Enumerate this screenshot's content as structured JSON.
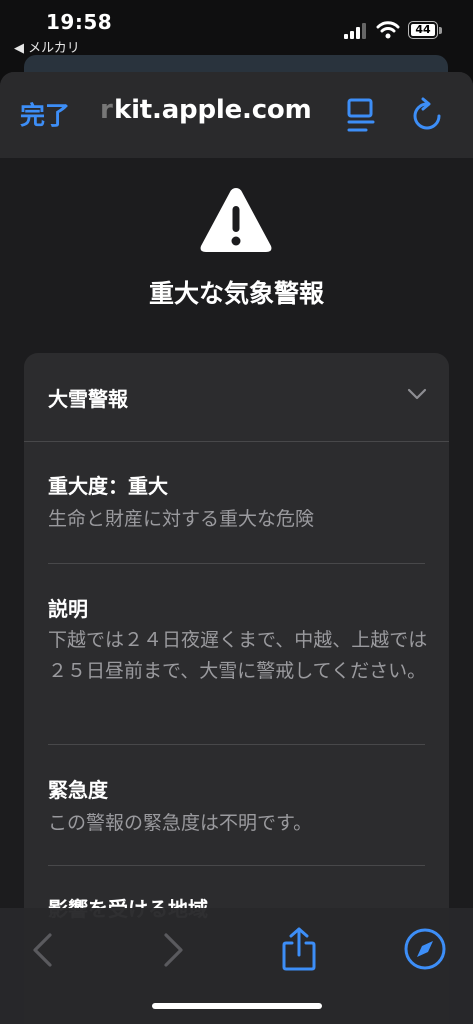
{
  "status_bar": {
    "time": "19:58",
    "back_app": "◀ メルカリ",
    "battery_level": "44"
  },
  "nav": {
    "done_label": "完了",
    "url_fade": "r",
    "url": "kit.apple.com",
    "reader_icon": "reader-icon",
    "reload_icon": "reload-icon"
  },
  "header": {
    "icon": "warning-triangle-icon",
    "title": "重大な気象警報"
  },
  "alert": {
    "type": "大雪警報",
    "sections": [
      {
        "title": "重大度：重大",
        "body": "生命と財産に対する重大な危険"
      },
      {
        "title": "説明",
        "body": "下越では２４日夜遅くまで、中越、上越では２５日昼前まで、大雪に警戒してください。"
      },
      {
        "title": "緊急度",
        "body": "この警報の緊急度は不明です。"
      },
      {
        "title": "影響を受ける地域",
        "body": ""
      }
    ]
  },
  "toolbar": {
    "back_icon": "back-icon",
    "forward_icon": "forward-icon",
    "share_icon": "share-icon",
    "compass_icon": "compass-icon"
  },
  "colors": {
    "accent": "#3d8ef7",
    "background": "#1c1c1e",
    "card": "#2c2c2e"
  }
}
